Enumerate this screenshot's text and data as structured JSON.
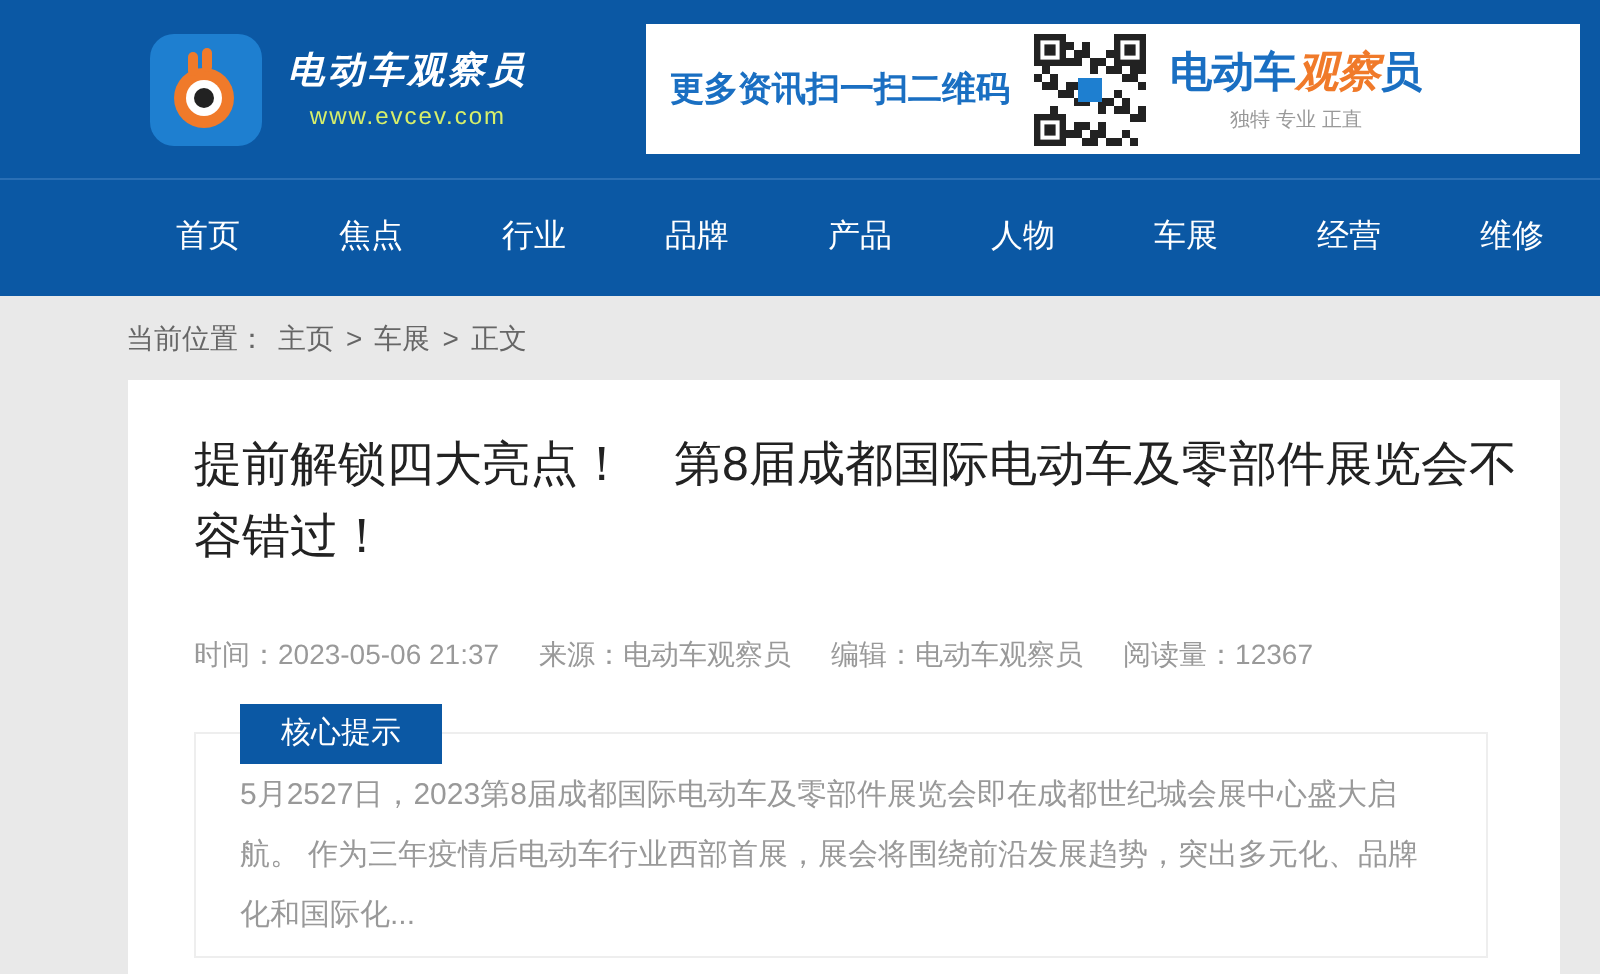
{
  "header": {
    "site_name": "电动车观察员",
    "site_url": "www.evcev.com",
    "banner": {
      "slogan": "更多资讯扫一扫二维码",
      "brand": [
        {
          "text": "电动车",
          "accent": false
        },
        {
          "text": "观察",
          "accent": true
        },
        {
          "text": "员",
          "accent": false
        }
      ],
      "tagline": "独特 专业 正直"
    }
  },
  "nav": [
    "首页",
    "焦点",
    "行业",
    "品牌",
    "产品",
    "人物",
    "车展",
    "经营",
    "维修"
  ],
  "breadcrumb": {
    "label": "当前位置：",
    "items": [
      "主页",
      "车展",
      "正文"
    ],
    "separator": ">"
  },
  "article": {
    "title": "提前解锁四大亮点！　第8届成都国际电动车及零部件展览会不容错过！",
    "meta": [
      "时间：2023-05-06 21:37",
      "来源：电动车观察员",
      "编辑：电动车观察员",
      "阅读量：12367"
    ],
    "summary": {
      "label": "核心提示",
      "text": "5月2527日，2023第8届成都国际电动车及零部件展览会即在成都世纪城会展中心盛大启航。 作为三年疫情后电动车行业西部首展，展会将围绕前沿发展趋势，突出多元化、品牌化和国际化..."
    }
  }
}
